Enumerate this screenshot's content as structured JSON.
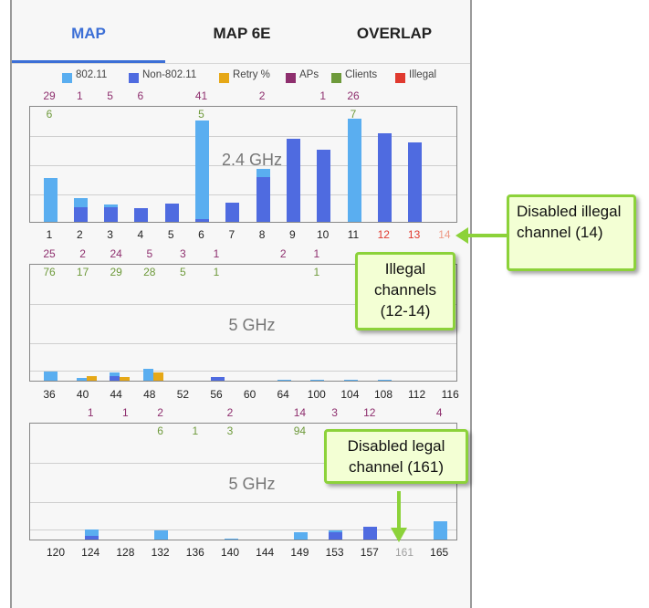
{
  "tabs": [
    {
      "label": "MAP",
      "active": true
    },
    {
      "label": "MAP 6E",
      "active": false
    },
    {
      "label": "OVERLAP",
      "active": false
    }
  ],
  "legend": [
    {
      "label": "802.11",
      "color": "#5aaef0"
    },
    {
      "label": "Non-802.11",
      "color": "#4f6be0"
    },
    {
      "label": "Retry %",
      "color": "#e6a817"
    },
    {
      "label": "APs",
      "color": "#8e2f6e"
    },
    {
      "label": "Clients",
      "color": "#6e9a3b"
    },
    {
      "label": "Illegal",
      "color": "#e03a2f"
    }
  ],
  "chart_data": [
    {
      "type": "bar",
      "band_label": "2.4 GHz",
      "channels": [
        "1",
        "2",
        "3",
        "4",
        "5",
        "6",
        "7",
        "8",
        "9",
        "10",
        "11",
        "12",
        "13",
        "14"
      ],
      "channel_status": [
        "legal",
        "legal",
        "legal",
        "legal",
        "legal",
        "legal",
        "legal",
        "legal",
        "legal",
        "legal",
        "legal",
        "illegal",
        "illegal",
        "illegal-disabled"
      ],
      "aps": [
        "29",
        "1",
        "5",
        "6",
        "",
        "41",
        "",
        "2",
        "",
        "1",
        "26",
        "",
        "",
        ""
      ],
      "clients": [
        "6",
        "",
        "",
        "",
        "",
        "5",
        "",
        "",
        "",
        "",
        "7",
        "",
        "",
        ""
      ],
      "series": [
        {
          "name": "802.11",
          "values": [
            38,
            21,
            15,
            12,
            16,
            88,
            17,
            46,
            0,
            0,
            90,
            0,
            0,
            0
          ]
        },
        {
          "name": "Non-802.11",
          "values": [
            0,
            13,
            13,
            12,
            16,
            2,
            17,
            39,
            72,
            63,
            0,
            77,
            69,
            0
          ]
        },
        {
          "name": "Retry %",
          "values": [
            0,
            0,
            0,
            0,
            0,
            0,
            0,
            0,
            0,
            0,
            0,
            0,
            0,
            0
          ]
        }
      ],
      "ylim": [
        0,
        100
      ]
    },
    {
      "type": "bar",
      "band_label": "5 GHz",
      "channels": [
        "36",
        "40",
        "44",
        "48",
        "52",
        "56",
        "60",
        "64",
        "100",
        "104",
        "108",
        "112",
        "116"
      ],
      "channel_status": [
        "legal",
        "legal",
        "legal",
        "legal",
        "legal",
        "legal",
        "legal",
        "legal",
        "legal",
        "legal",
        "legal",
        "legal",
        "legal"
      ],
      "aps": [
        "25",
        "2",
        "24",
        "5",
        "3",
        "1",
        "",
        "2",
        "1",
        "",
        "",
        "",
        ""
      ],
      "clients": [
        "76",
        "17",
        "29",
        "28",
        "5",
        "1",
        "",
        "",
        "1",
        "",
        "",
        "",
        ""
      ],
      "series": [
        {
          "name": "802.11",
          "values": [
            8,
            2,
            7,
            10,
            0,
            3,
            0,
            1,
            1,
            1,
            1,
            0,
            0
          ]
        },
        {
          "name": "Non-802.11",
          "values": [
            0,
            0,
            4,
            0,
            0,
            3,
            0,
            0,
            0,
            0,
            0,
            0,
            0
          ]
        },
        {
          "name": "Retry %",
          "values": [
            0,
            4,
            3,
            7,
            0,
            0,
            0,
            0,
            0,
            0,
            0,
            0,
            0
          ]
        }
      ],
      "ylim": [
        0,
        100
      ]
    },
    {
      "type": "bar",
      "band_label": "5 GHz",
      "channels": [
        "120",
        "124",
        "128",
        "132",
        "136",
        "140",
        "144",
        "149",
        "153",
        "157",
        "161",
        "165"
      ],
      "channel_status": [
        "legal",
        "legal",
        "legal",
        "legal",
        "legal",
        "legal",
        "legal",
        "legal",
        "legal",
        "legal",
        "legal-disabled",
        "legal"
      ],
      "aps": [
        "",
        "1",
        "1",
        "2",
        "",
        "2",
        "",
        "14",
        "3",
        "12",
        "",
        "4"
      ],
      "clients": [
        "",
        "",
        "",
        "6",
        "1",
        "3",
        "",
        "94",
        "",
        "",
        "",
        ""
      ],
      "series": [
        {
          "name": "802.11",
          "values": [
            0,
            9,
            0,
            8,
            0,
            1,
            0,
            6,
            8,
            7,
            0,
            16
          ]
        },
        {
          "name": "Non-802.11",
          "values": [
            0,
            3,
            0,
            0,
            0,
            0,
            0,
            0,
            6,
            11,
            0,
            0
          ]
        },
        {
          "name": "Retry %",
          "values": [
            0,
            0,
            0,
            0,
            0,
            0,
            0,
            0,
            0,
            0,
            0,
            0
          ]
        }
      ],
      "ylim": [
        0,
        100
      ]
    }
  ],
  "callouts": [
    {
      "id": "disabled-illegal",
      "text": "Disabled illegal channel (14)"
    },
    {
      "id": "illegal-channels",
      "text": "Illegal channels (12-14)"
    },
    {
      "id": "disabled-legal",
      "text": "Disabled legal channel (161)"
    }
  ],
  "colors": {
    "accent": "#3c6fd6",
    "ap_text": "#8e2f6e",
    "client_text": "#6e9a3b",
    "illegal_text": "#e03a2f",
    "disabled_text": "#a0a0a0",
    "callout_border": "#8cd23a",
    "callout_fill": "#f3ffd4"
  }
}
